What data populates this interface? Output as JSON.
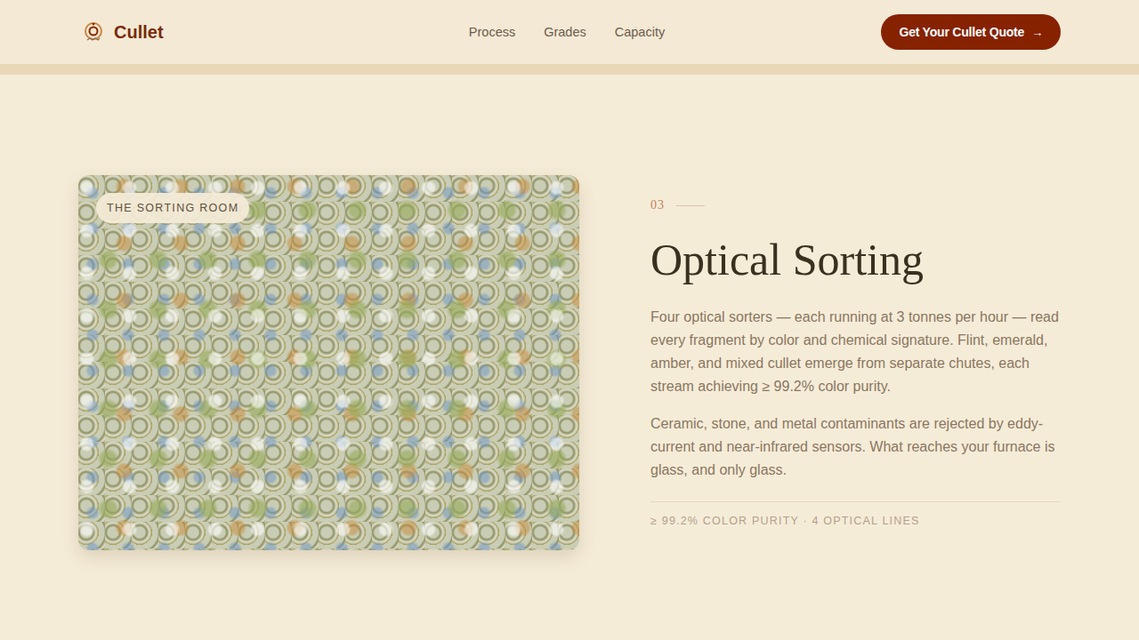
{
  "header": {
    "logo": "Cullet",
    "nav": [
      "Process",
      "Grades",
      "Capacity"
    ],
    "cta": {
      "label": "Get Your Cullet Quote",
      "icon": "→"
    }
  },
  "section": {
    "image": {
      "badge": "THE SORTING ROOM"
    },
    "number": "03",
    "title": "Optical Sorting",
    "paragraphs": [
      "Four optical sorters — each running at 3 tonnes per hour — read every fragment by color and chemical signature. Flint, emerald, amber, and mixed cullet emerge from separate chutes, each stream achieving ≥ 99.2% color purity.",
      "Ceramic, stone, and metal contaminants are rejected by eddy-current and near-infrared sensors. What reaches your furnace is glass, and only glass."
    ],
    "stats": "≥ 99.2% COLOR PURITY · 4 OPTICAL LINES"
  }
}
